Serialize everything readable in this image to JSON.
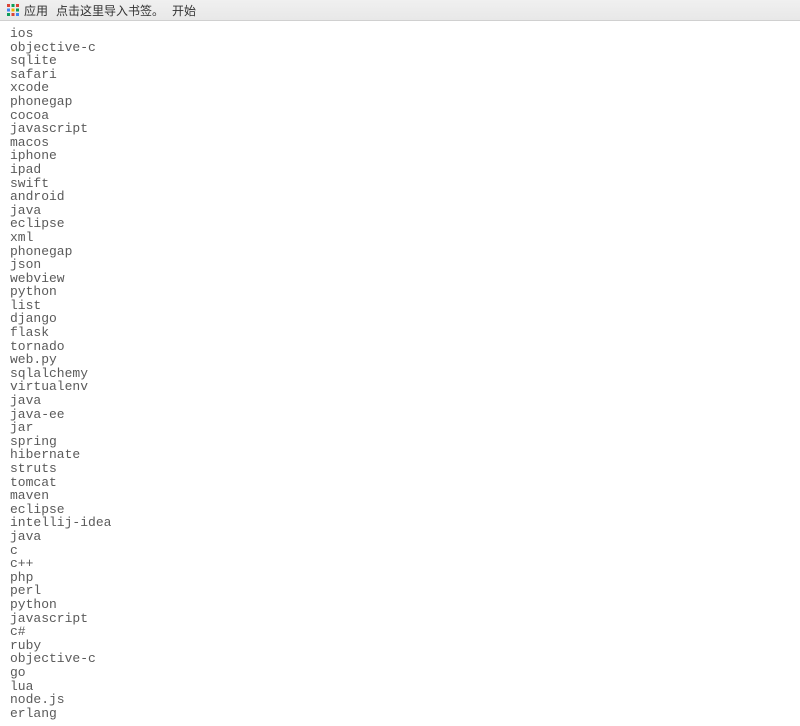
{
  "bookmarkBar": {
    "appsLabel": "应用",
    "importLabel": "点击这里导入书签。",
    "startLabel": "开始"
  },
  "tags": [
    "ios",
    "objective-c",
    "sqlite",
    "safari",
    "xcode",
    "phonegap",
    "cocoa",
    "javascript",
    "macos",
    "iphone",
    "ipad",
    "swift",
    "android",
    "java",
    "eclipse",
    "xml",
    "phonegap",
    "json",
    "webview",
    "python",
    "list",
    "django",
    "flask",
    "tornado",
    "web.py",
    "sqlalchemy",
    "virtualenv",
    "java",
    "java-ee",
    "jar",
    "spring",
    "hibernate",
    "struts",
    "tomcat",
    "maven",
    "eclipse",
    "intellij-idea",
    "java",
    "c",
    "c++",
    "php",
    "perl",
    "python",
    "javascript",
    "c#",
    "ruby",
    "objective-c",
    "go",
    "lua",
    "node.js",
    "erlang"
  ]
}
